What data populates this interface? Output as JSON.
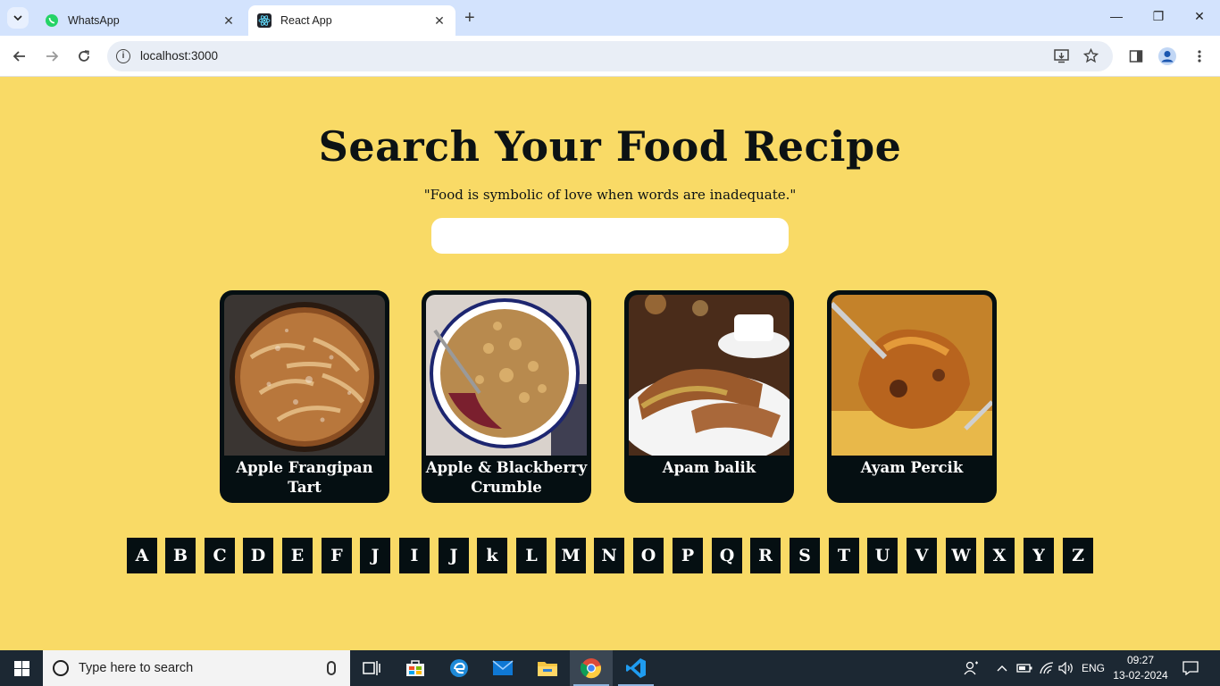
{
  "browser": {
    "tabs": [
      {
        "title": "WhatsApp",
        "active": false,
        "icon": "whatsapp-icon"
      },
      {
        "title": "React App",
        "active": true,
        "icon": "react-icon"
      }
    ],
    "url": "localhost:3000"
  },
  "page": {
    "heading": "Search Your Food Recipe",
    "quote": "\"Food is symbolic of love when words are inadequate.\"",
    "search_placeholder": "",
    "cards": [
      {
        "name": "Apple Frangipan Tart"
      },
      {
        "name": "Apple & Blackberry Crumble"
      },
      {
        "name": "Apam balik"
      },
      {
        "name": "Ayam Percik"
      }
    ],
    "letters": [
      "A",
      "B",
      "C",
      "D",
      "E",
      "F",
      "J",
      "I",
      "J",
      "k",
      "L",
      "M",
      "N",
      "O",
      "P",
      "Q",
      "R",
      "S",
      "T",
      "U",
      "V",
      "W",
      "X",
      "Y",
      "Z"
    ]
  },
  "taskbar": {
    "search_placeholder": "Type here to search",
    "language": "ENG",
    "time": "09:27",
    "date": "13-02-2024"
  },
  "colors": {
    "page_background": "#f9da66",
    "card_background": "#050f12",
    "letter_background": "#050f12"
  }
}
